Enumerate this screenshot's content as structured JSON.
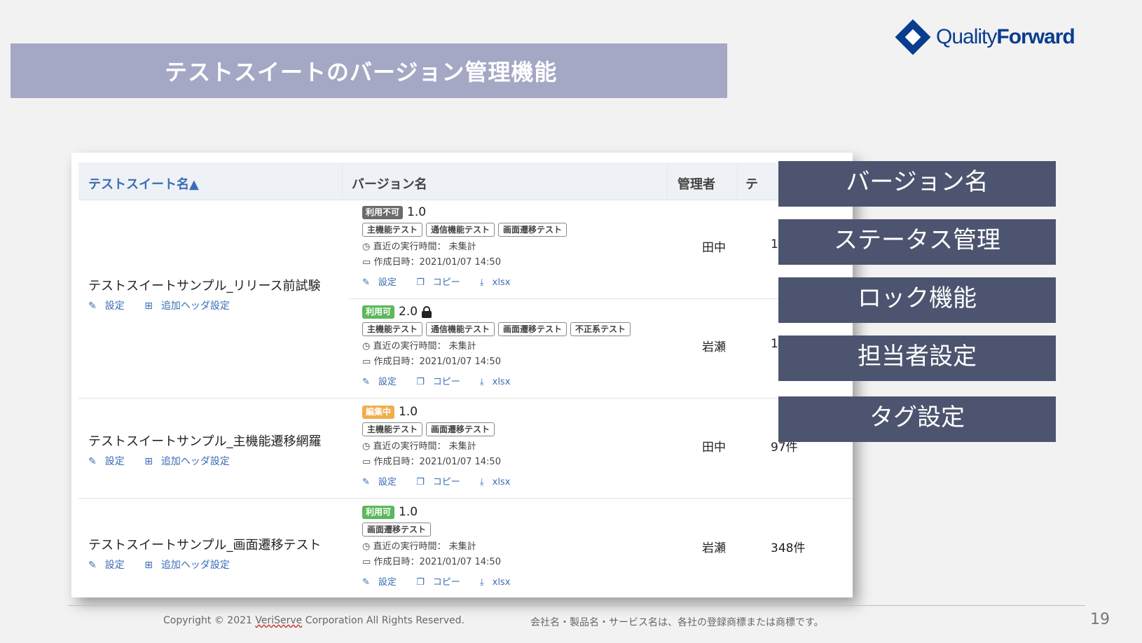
{
  "slide": {
    "title": "テストスイートのバージョン管理機能",
    "logo": {
      "light": "Quality",
      "bold": "Forward"
    },
    "footer": {
      "copyright_prefix": "Copyright © 2021 ",
      "company": "VeriServe",
      "copyright_suffix": " Corporation All Rights Reserved.",
      "trademark": "会社名・製品名・サービス名は、各社の登録商標または商標です。"
    },
    "page_number": "19"
  },
  "table": {
    "headers": {
      "suite_name": "テストスイート名",
      "sort_icon": "▲",
      "version_name": "バージョン名",
      "manager": "管理者",
      "cut": "テ"
    },
    "link_labels": {
      "settings": "設定",
      "extra_header": "追加ヘッダ設定",
      "copy": "コピー",
      "xlsx": "xlsx"
    },
    "meta_labels": {
      "last_run": "直近の実行時間：",
      "created": "作成日時："
    },
    "rows": [
      {
        "suite": "テストスイートサンプル_リリース前試験",
        "versions": [
          {
            "status": "利用不可",
            "status_color": "#6b6b6b",
            "version": "1.0",
            "locked": false,
            "tags": [
              "主機能テスト",
              "通信機能テスト",
              "画面遷移テスト"
            ],
            "last_run": "未集計",
            "created": "2021/01/07 14:50",
            "manager": "田中",
            "count": "1"
          },
          {
            "status": "利用可",
            "status_color": "#5cb85c",
            "version": "2.0",
            "locked": true,
            "tags": [
              "主機能テスト",
              "通信機能テスト",
              "画面遷移テスト",
              "不正系テスト"
            ],
            "last_run": "未集計",
            "created": "2021/01/07 14:50",
            "manager": "岩瀬",
            "count": "1"
          }
        ]
      },
      {
        "suite": "テストスイートサンプル_主機能遷移網羅",
        "versions": [
          {
            "status": "編集中",
            "status_color": "#f0ad4e",
            "version": "1.0",
            "locked": false,
            "tags": [
              "主機能テスト",
              "画面遷移テスト"
            ],
            "last_run": "未集計",
            "created": "2021/01/07 14:50",
            "manager": "田中",
            "count": "97件"
          }
        ]
      },
      {
        "suite": "テストスイートサンプル_画面遷移テスト",
        "versions": [
          {
            "status": "利用可",
            "status_color": "#5cb85c",
            "version": "1.0",
            "locked": false,
            "tags": [
              "画面遷移テスト"
            ],
            "last_run": "未集計",
            "created": "2021/01/07 14:50",
            "manager": "岩瀬",
            "count": "348件"
          }
        ]
      }
    ]
  },
  "callouts": [
    "バージョン名",
    "ステータス管理",
    "ロック機能",
    "担当者設定",
    "タグ設定"
  ]
}
